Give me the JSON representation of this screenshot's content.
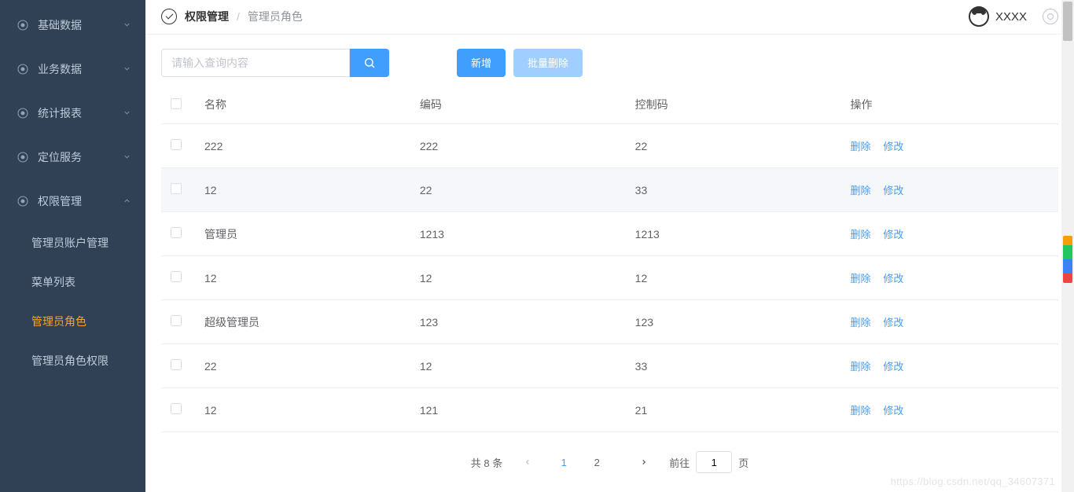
{
  "sidebar": {
    "items": [
      {
        "label": "基础数据",
        "expanded": false
      },
      {
        "label": "业务数据",
        "expanded": false
      },
      {
        "label": "统计报表",
        "expanded": false
      },
      {
        "label": "定位服务",
        "expanded": false
      },
      {
        "label": "权限管理",
        "expanded": true
      }
    ],
    "submenu": [
      {
        "label": "管理员账户管理",
        "active": false
      },
      {
        "label": "菜单列表",
        "active": false
      },
      {
        "label": "管理员角色",
        "active": true
      },
      {
        "label": "管理员角色权限",
        "active": false
      }
    ]
  },
  "header": {
    "breadcrumb_main": "权限管理",
    "breadcrumb_sub": "管理员角色",
    "username": "XXXX"
  },
  "toolbar": {
    "search_placeholder": "请输入查询内容",
    "add_label": "新增",
    "batch_delete_label": "批量删除"
  },
  "table": {
    "headers": {
      "name": "名称",
      "code": "编码",
      "ctrl": "控制码",
      "ops": "操作"
    },
    "rows": [
      {
        "name": "222",
        "code": "222",
        "ctrl": "22"
      },
      {
        "name": "12",
        "code": "22",
        "ctrl": "33"
      },
      {
        "name": "管理员",
        "code": "1213",
        "ctrl": "1213"
      },
      {
        "name": "12",
        "code": "12",
        "ctrl": "12"
      },
      {
        "name": "超级管理员",
        "code": "123",
        "ctrl": "123"
      },
      {
        "name": "22",
        "code": "12",
        "ctrl": "33"
      },
      {
        "name": "12",
        "code": "121",
        "ctrl": "21"
      }
    ],
    "action_delete": "删除",
    "action_edit": "修改"
  },
  "pagination": {
    "total_text": "共 8 条",
    "pages": [
      "1",
      "2"
    ],
    "current": 1,
    "jump_prefix": "前往",
    "jump_suffix": "页",
    "jump_value": "1"
  },
  "watermark": "https://blog.csdn.net/qq_34607371"
}
